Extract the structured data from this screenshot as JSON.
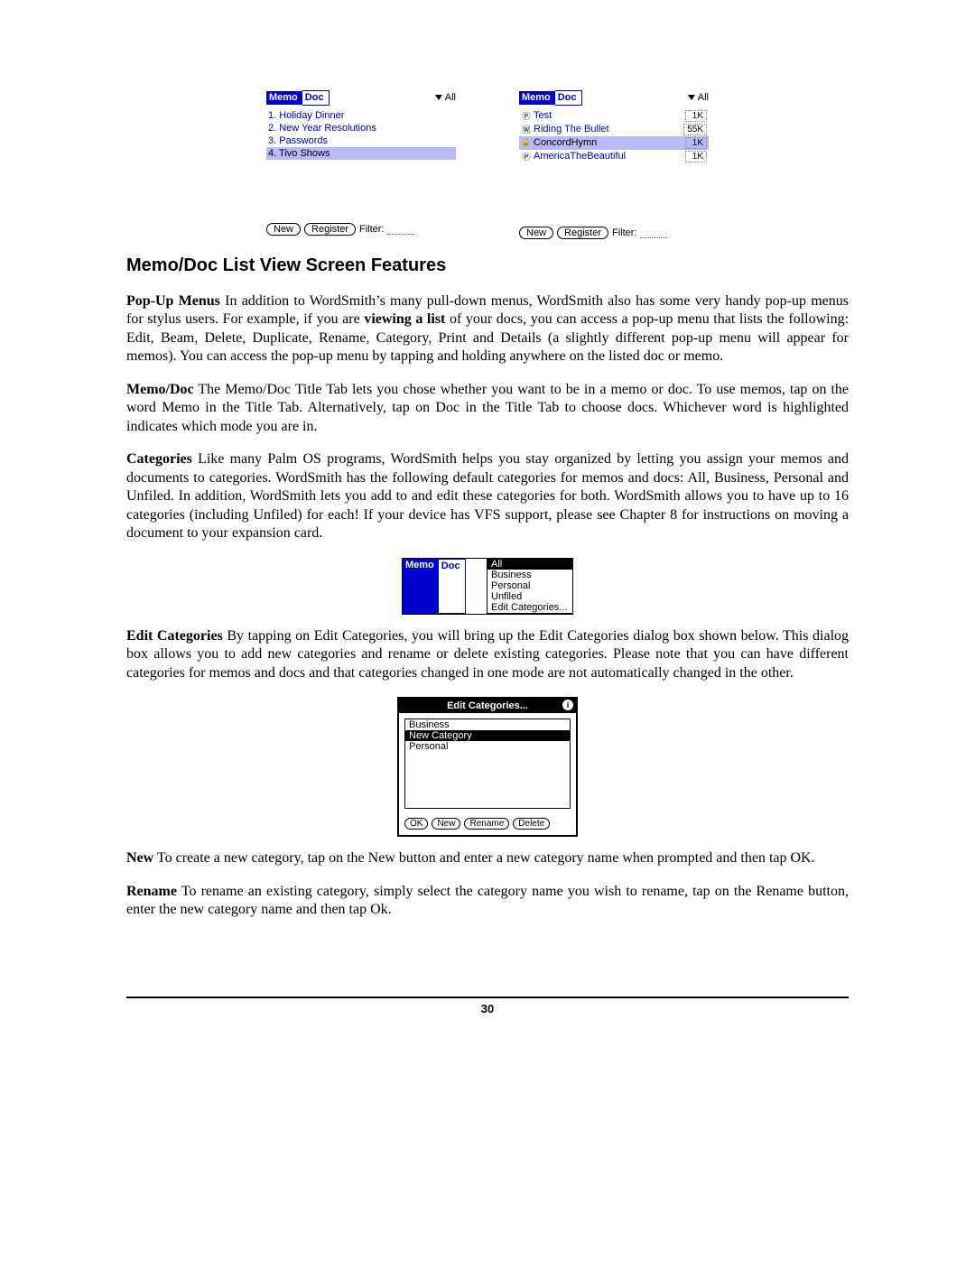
{
  "section_heading": "Memo/Doc List View Screen Features",
  "page_number": "30",
  "screenshot_left": {
    "tab_active": "Memo",
    "tab_inactive": "Doc",
    "category": "All",
    "items": [
      {
        "text": "1. Holiday Dinner",
        "selected": false
      },
      {
        "text": "2. New Year Resolutions",
        "selected": false
      },
      {
        "text": "3. Passwords",
        "selected": false
      },
      {
        "text": "4. Tivo Shows",
        "selected": true
      }
    ],
    "btn_new": "New",
    "btn_register": "Register",
    "filter_label": "Filter:"
  },
  "screenshot_right": {
    "tab_active": "Memo",
    "tab_inactive": "Doc",
    "category": "All",
    "items": [
      {
        "icon": "P",
        "text": "Test",
        "size": "1K",
        "selected": false
      },
      {
        "icon": "W",
        "text": "Riding The Bullet",
        "size": "55K",
        "selected": false
      },
      {
        "icon": "lock",
        "text": "ConcordHymn",
        "size": "1K",
        "selected": true
      },
      {
        "icon": "P",
        "text": "AmericaTheBeautiful",
        "size": "1K",
        "selected": false
      }
    ],
    "btn_new": "New",
    "btn_register": "Register",
    "filter_label": "Filter:"
  },
  "mini": {
    "tab_active": "Memo",
    "tab_inactive": "Doc",
    "options": [
      "All",
      "Business",
      "Personal",
      "Unfiled",
      "Edit Categories..."
    ],
    "selected": "All"
  },
  "dialog": {
    "title": "Edit Categories...",
    "items": [
      {
        "text": "Business",
        "selected": false
      },
      {
        "text": "New Category",
        "selected": true
      },
      {
        "text": "Personal",
        "selected": false
      }
    ],
    "btn_ok": "OK",
    "btn_new": "New",
    "btn_rename": "Rename",
    "btn_delete": "Delete"
  },
  "para_popup_lead": "Pop-Up Menus",
  "para_popup_a": " In addition to WordSmith’s many pull-down menus, WordSmith also has some very handy pop-up menus for stylus users.  For example, if you are ",
  "para_popup_bold": "viewing a list",
  "para_popup_b": " of your docs, you can access a pop-up menu that lists the following: Edit, Beam, Delete, Duplicate, Rename, Category, Print and Details (a slightly different pop-up menu will appear for memos).  You can access the pop-up menu by tapping and holding anywhere on the listed doc or memo.",
  "para_memodoc_lead": "Memo/Doc",
  "para_memodoc": " The Memo/Doc Title Tab lets you chose whether you want to be in a memo or doc.  To use memos, tap on the word Memo in the Title Tab.  Alternatively, tap on Doc in the Title Tab to choose docs.  Whichever word is highlighted indicates which mode you are in.",
  "para_categories_lead": "Categories",
  "para_categories": " Like many Palm OS programs, WordSmith helps you stay organized by letting you assign your memos and documents to categories.  WordSmith has the following default categories for memos and docs:  All, Business, Personal and Unfiled.  In addition, WordSmith lets you add to and edit these categories for both.  WordSmith allows you to have up to 16 categories (including Unfiled) for each!  If your device has VFS support, please see Chapter 8 for instructions on moving a document to your expansion card.",
  "para_editcat_lead": "Edit Categories",
  "para_editcat": " By tapping on Edit Categories, you will bring up the Edit Categories dialog box shown below.  This dialog box allows you to add new categories and rename or delete existing categories. Please note that you can have different categories for memos and docs and that categories changed in one mode are not automatically changed in the other.",
  "para_new_lead": "New",
  "para_new": " To create a new category, tap on the New button and enter a new category name when prompted and then tap OK.",
  "para_rename_lead": "Rename",
  "para_rename": " To rename an existing category, simply select the category name you wish to rename, tap on the Rename button, enter the new category name and then tap Ok."
}
